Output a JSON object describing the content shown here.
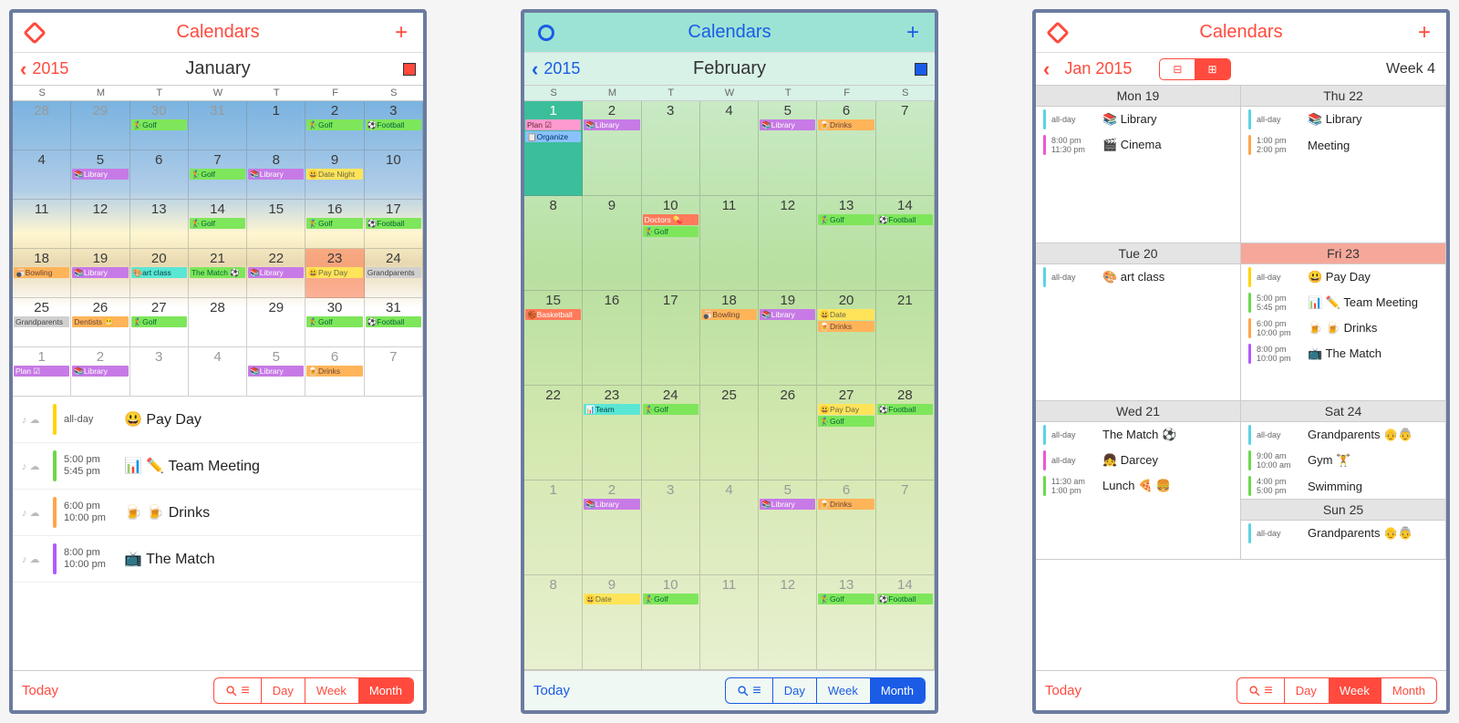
{
  "phones": [
    {
      "accent": "#ff4a3d",
      "header_title": "Calendars",
      "year": "2015",
      "month": "January",
      "dow": [
        "S",
        "M",
        "T",
        "W",
        "T",
        "F",
        "S"
      ],
      "weeks": [
        [
          {
            "n": "28",
            "dim": true
          },
          {
            "n": "29",
            "dim": true
          },
          {
            "n": "30",
            "dim": true,
            "ev": [
              {
                "t": "🏌Golf",
                "c": "c-green"
              }
            ]
          },
          {
            "n": "31",
            "dim": true
          },
          {
            "n": "1"
          },
          {
            "n": "2",
            "ev": [
              {
                "t": "🏌Golf",
                "c": "c-green"
              }
            ]
          },
          {
            "n": "3",
            "ev": [
              {
                "t": "⚽Football",
                "c": "c-green"
              }
            ]
          }
        ],
        [
          {
            "n": "4"
          },
          {
            "n": "5",
            "ev": [
              {
                "t": "📚Library",
                "c": "c-purple"
              }
            ]
          },
          {
            "n": "6"
          },
          {
            "n": "7",
            "ev": [
              {
                "t": "🏌Golf",
                "c": "c-green"
              }
            ]
          },
          {
            "n": "8",
            "ev": [
              {
                "t": "📚Library",
                "c": "c-purple"
              }
            ]
          },
          {
            "n": "9",
            "ev": [
              {
                "t": "😃Date Night",
                "c": "c-yellow"
              }
            ]
          },
          {
            "n": "10"
          }
        ],
        [
          {
            "n": "11"
          },
          {
            "n": "12"
          },
          {
            "n": "13"
          },
          {
            "n": "14",
            "ev": [
              {
                "t": "🏌Golf",
                "c": "c-green"
              }
            ]
          },
          {
            "n": "15"
          },
          {
            "n": "16",
            "ev": [
              {
                "t": "🏌Golf",
                "c": "c-green"
              }
            ]
          },
          {
            "n": "17",
            "ev": [
              {
                "t": "⚽Football",
                "c": "c-green"
              }
            ]
          }
        ],
        [
          {
            "n": "18",
            "ev": [
              {
                "t": "🎳Bowling",
                "c": "c-orange"
              }
            ]
          },
          {
            "n": "19",
            "ev": [
              {
                "t": "📚Library",
                "c": "c-purple"
              }
            ]
          },
          {
            "n": "20",
            "ev": [
              {
                "t": "🎨art class",
                "c": "c-teal"
              }
            ]
          },
          {
            "n": "21",
            "ev": [
              {
                "t": "The Match ⚽",
                "c": "c-green"
              }
            ]
          },
          {
            "n": "22",
            "ev": [
              {
                "t": "📚Library",
                "c": "c-purple"
              }
            ]
          },
          {
            "n": "23",
            "sel": true,
            "ev": [
              {
                "t": "😃Pay Day",
                "c": "c-yellow"
              }
            ]
          },
          {
            "n": "24",
            "ev": [
              {
                "t": "Grandparents",
                "c": "c-gray"
              }
            ]
          }
        ],
        [
          {
            "n": "25",
            "ev": [
              {
                "t": "Grandparents",
                "c": "c-gray"
              }
            ]
          },
          {
            "n": "26",
            "ev": [
              {
                "t": "Dentists 😬",
                "c": "c-orange"
              }
            ]
          },
          {
            "n": "27",
            "ev": [
              {
                "t": "🏌Golf",
                "c": "c-green"
              }
            ]
          },
          {
            "n": "28"
          },
          {
            "n": "29"
          },
          {
            "n": "30",
            "ev": [
              {
                "t": "🏌Golf",
                "c": "c-green"
              }
            ]
          },
          {
            "n": "31",
            "ev": [
              {
                "t": "⚽Football",
                "c": "c-green"
              }
            ]
          }
        ],
        [
          {
            "n": "1",
            "dim": true,
            "ev": [
              {
                "t": "Plan ☑",
                "c": "c-purple"
              }
            ]
          },
          {
            "n": "2",
            "dim": true,
            "ev": [
              {
                "t": "📚Library",
                "c": "c-purple"
              }
            ]
          },
          {
            "n": "3",
            "dim": true
          },
          {
            "n": "4",
            "dim": true
          },
          {
            "n": "5",
            "dim": true,
            "ev": [
              {
                "t": "📚Library",
                "c": "c-purple"
              }
            ]
          },
          {
            "n": "6",
            "dim": true,
            "ev": [
              {
                "t": "🍺Drinks",
                "c": "c-orange"
              }
            ]
          },
          {
            "n": "7",
            "dim": true
          }
        ]
      ],
      "agenda": [
        {
          "bar": "#ffd400",
          "t1": "all-day",
          "t2": "",
          "title": "😃 Pay Day"
        },
        {
          "bar": "#6bd94a",
          "t1": "5:00 pm",
          "t2": "5:45 pm",
          "title": "📊 ✏️ Team Meeting"
        },
        {
          "bar": "#ffa54a",
          "t1": "6:00 pm",
          "t2": "10:00 pm",
          "title": "🍺 🍺 Drinks"
        },
        {
          "bar": "#b05aff",
          "t1": "8:00 pm",
          "t2": "10:00 pm",
          "title": "📺 The Match"
        }
      ],
      "footer": {
        "today": "Today",
        "tabs": [
          "Day",
          "Week",
          "Month"
        ],
        "active": 2
      }
    },
    {
      "accent": "#1a5ce6",
      "header_title": "Calendars",
      "year": "2015",
      "month": "February",
      "dow": [
        "S",
        "M",
        "T",
        "W",
        "T",
        "F",
        "S"
      ],
      "weeks": [
        [
          {
            "n": "1",
            "today": true,
            "ev": [
              {
                "t": "Plan ☑",
                "c": "c-pink"
              },
              {
                "t": "📋Organize",
                "c": "c-blue"
              }
            ]
          },
          {
            "n": "2",
            "ev": [
              {
                "t": "📚Library",
                "c": "c-purple"
              }
            ]
          },
          {
            "n": "3"
          },
          {
            "n": "4"
          },
          {
            "n": "5",
            "ev": [
              {
                "t": "📚Library",
                "c": "c-purple"
              }
            ]
          },
          {
            "n": "6",
            "ev": [
              {
                "t": "🍺Drinks",
                "c": "c-orange"
              }
            ]
          },
          {
            "n": "7"
          }
        ],
        [
          {
            "n": "8"
          },
          {
            "n": "9"
          },
          {
            "n": "10",
            "ev": [
              {
                "t": "Doctors 💊",
                "c": "c-red"
              },
              {
                "t": "🏌Golf",
                "c": "c-green"
              }
            ]
          },
          {
            "n": "11"
          },
          {
            "n": "12"
          },
          {
            "n": "13",
            "ev": [
              {
                "t": "🏌Golf",
                "c": "c-green"
              }
            ]
          },
          {
            "n": "14",
            "ev": [
              {
                "t": "⚽Football",
                "c": "c-green"
              }
            ]
          }
        ],
        [
          {
            "n": "15",
            "ev": [
              {
                "t": "🏀Basketball",
                "c": "c-red"
              }
            ]
          },
          {
            "n": "16"
          },
          {
            "n": "17"
          },
          {
            "n": "18",
            "ev": [
              {
                "t": "🎳Bowling",
                "c": "c-orange"
              }
            ]
          },
          {
            "n": "19",
            "ev": [
              {
                "t": "📚Library",
                "c": "c-purple"
              }
            ]
          },
          {
            "n": "20",
            "ev": [
              {
                "t": "😃Date",
                "c": "c-yellow"
              },
              {
                "t": "🍺Drinks",
                "c": "c-orange"
              }
            ]
          },
          {
            "n": "21"
          }
        ],
        [
          {
            "n": "22"
          },
          {
            "n": "23",
            "ev": [
              {
                "t": "📊Team",
                "c": "c-teal"
              }
            ]
          },
          {
            "n": "24",
            "ev": [
              {
                "t": "🏌Golf",
                "c": "c-green"
              }
            ]
          },
          {
            "n": "25"
          },
          {
            "n": "26"
          },
          {
            "n": "27",
            "ev": [
              {
                "t": "😃Pay Day",
                "c": "c-yellow"
              },
              {
                "t": "🏌Golf",
                "c": "c-green"
              }
            ]
          },
          {
            "n": "28",
            "ev": [
              {
                "t": "⚽Football",
                "c": "c-green"
              }
            ]
          }
        ],
        [
          {
            "n": "1",
            "dim": true
          },
          {
            "n": "2",
            "dim": true,
            "ev": [
              {
                "t": "📚Library",
                "c": "c-purple"
              }
            ]
          },
          {
            "n": "3",
            "dim": true
          },
          {
            "n": "4",
            "dim": true
          },
          {
            "n": "5",
            "dim": true,
            "ev": [
              {
                "t": "📚Library",
                "c": "c-purple"
              }
            ]
          },
          {
            "n": "6",
            "dim": true,
            "ev": [
              {
                "t": "🍺Drinks",
                "c": "c-orange"
              }
            ]
          },
          {
            "n": "7",
            "dim": true
          }
        ],
        [
          {
            "n": "8",
            "dim": true
          },
          {
            "n": "9",
            "dim": true,
            "ev": [
              {
                "t": "😃Date",
                "c": "c-yellow"
              }
            ]
          },
          {
            "n": "10",
            "dim": true,
            "ev": [
              {
                "t": "🏌Golf",
                "c": "c-green"
              }
            ]
          },
          {
            "n": "11",
            "dim": true
          },
          {
            "n": "12",
            "dim": true
          },
          {
            "n": "13",
            "dim": true,
            "ev": [
              {
                "t": "🏌Golf",
                "c": "c-green"
              }
            ]
          },
          {
            "n": "14",
            "dim": true,
            "ev": [
              {
                "t": "⚽Football",
                "c": "c-green"
              }
            ]
          }
        ]
      ],
      "footer": {
        "today": "Today",
        "tabs": [
          "Day",
          "Week",
          "Month"
        ],
        "active": 2
      }
    },
    {
      "accent": "#ff4a3d",
      "header_title": "Calendars",
      "month_year": "Jan 2015",
      "week_label": "Week 4",
      "days": [
        {
          "label": "Mon 19",
          "ev": [
            {
              "bar": "#5ad4e6",
              "t1": "all-day",
              "t2": "",
              "title": "📚 Library"
            },
            {
              "bar": "#e65ad4",
              "t1": "8:00 pm",
              "t2": "11:30 pm",
              "title": "🎬 Cinema"
            }
          ]
        },
        {
          "label": "Thu 22",
          "ev": [
            {
              "bar": "#5ad4e6",
              "t1": "all-day",
              "t2": "",
              "title": "📚 Library"
            },
            {
              "bar": "#ffa54a",
              "t1": "1:00 pm",
              "t2": "2:00 pm",
              "title": "Meeting"
            }
          ]
        },
        {
          "label": "Tue 20",
          "ev": [
            {
              "bar": "#5ad4e6",
              "t1": "all-day",
              "t2": "",
              "title": "🎨 art class"
            }
          ]
        },
        {
          "label": "Fri 23",
          "hl": true,
          "ev": [
            {
              "bar": "#ffd400",
              "t1": "all-day",
              "t2": "",
              "title": "😃 Pay Day"
            },
            {
              "bar": "#6bd94a",
              "t1": "5:00 pm",
              "t2": "5:45 pm",
              "title": "📊 ✏️ Team Meeting"
            },
            {
              "bar": "#ffa54a",
              "t1": "6:00 pm",
              "t2": "10:00 pm",
              "title": "🍺 🍺 Drinks"
            },
            {
              "bar": "#b05aff",
              "t1": "8:00 pm",
              "t2": "10:00 pm",
              "title": "📺 The Match"
            }
          ]
        },
        {
          "label": "Wed 21",
          "ev": [
            {
              "bar": "#5ad4e6",
              "t1": "all-day",
              "t2": "",
              "title": "The Match ⚽"
            },
            {
              "bar": "#e65ad4",
              "t1": "all-day",
              "t2": "",
              "title": "👧 Darcey"
            },
            {
              "bar": "#6bd94a",
              "t1": "11:30 am",
              "t2": "1:00 pm",
              "title": "Lunch 🍕 🍔"
            }
          ]
        },
        {
          "label": "Sat 24",
          "ev": [
            {
              "bar": "#5ad4e6",
              "t1": "all-day",
              "t2": "",
              "title": "Grandparents 👴👵"
            },
            {
              "bar": "#6bd94a",
              "t1": "9:00 am",
              "t2": "10:00 am",
              "title": "Gym 🏋️"
            },
            {
              "bar": "#6bd94a",
              "t1": "4:00 pm",
              "t2": "5:00 pm",
              "title": "Swimming"
            }
          ]
        },
        {
          "label": "Sun 25",
          "ev": [
            {
              "bar": "#5ad4e6",
              "t1": "all-day",
              "t2": "",
              "title": "Grandparents 👴👵"
            }
          ]
        }
      ],
      "footer": {
        "today": "Today",
        "tabs": [
          "Day",
          "Week",
          "Month"
        ],
        "active": 1
      }
    }
  ]
}
